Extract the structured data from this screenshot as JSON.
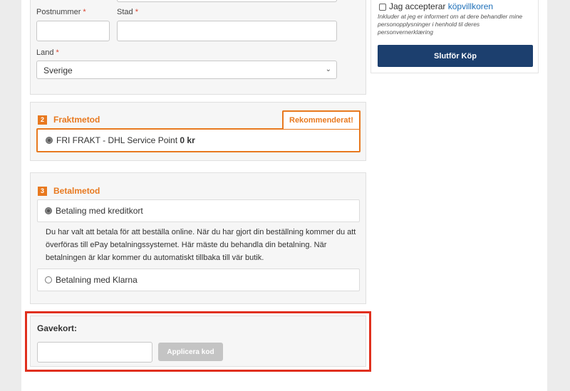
{
  "address": {
    "postal_label": "Postnummer",
    "city_label": "Stad",
    "country_label": "Land",
    "required_mark": "*",
    "country_value": "Sverige"
  },
  "shipping": {
    "number": "2",
    "title": "Fraktmetod",
    "recommended_tag": "Rekommenderat!",
    "option_label": "FRI FRAKT - DHL Service Point",
    "option_price": "0 kr"
  },
  "payment": {
    "number": "3",
    "title": "Betalmetod",
    "option_card": "Betaling med kreditkort",
    "info_text": "Du har valt att betala för att beställa online. När du har gjort din beställning kommer du att överföras till ePay betalningssystemet. Här mäste du behandla din betalning. När betalningen är klar kommer du automatiskt tillbaka till vär butik.",
    "option_klarna": "Betalning med Klarna"
  },
  "giftcard": {
    "label": "Gavekort:",
    "input_placeholder": "",
    "apply_label": "Applicera kod"
  },
  "checkout": {
    "accept_text": "Jag accepterar",
    "terms_link": "köpvillkoren",
    "disclaimer": "Inkluder at jeg er informert om at dere behandler mine personopplysninger i henhold til deres personvernerklæring",
    "complete_label": "Slutför Köp"
  },
  "colors": {
    "accent": "#e8791f",
    "primary_button": "#1c3f6e",
    "highlight_frame": "#e0301e",
    "link": "#1d6fb8"
  }
}
